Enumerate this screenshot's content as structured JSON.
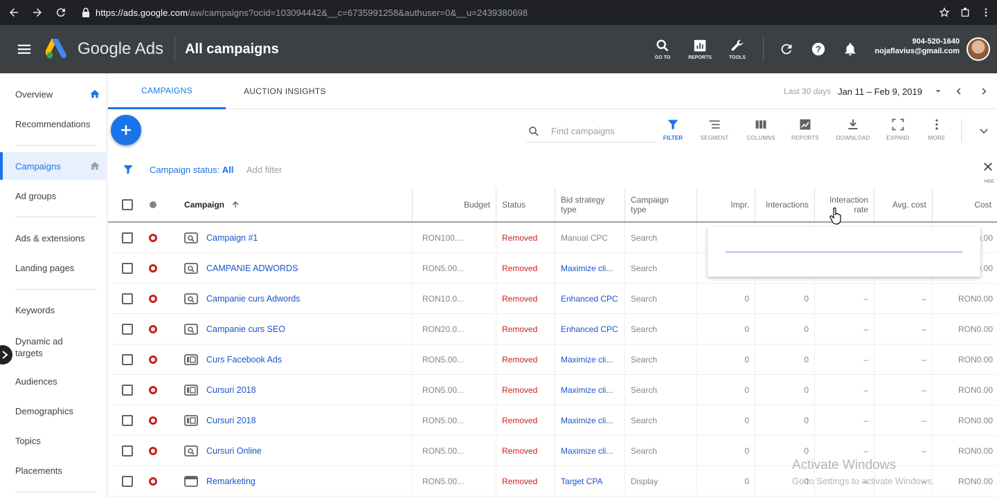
{
  "browser": {
    "url_host": "https://ads.google.com",
    "url_path": "/aw/campaigns?ocid=103094442&__c=6735991258&authuser=0&__u=2439380698"
  },
  "header": {
    "brand": "Google Ads",
    "page_title": "All campaigns",
    "tools": [
      {
        "label": "GO TO",
        "icon": "search-icon"
      },
      {
        "label": "REPORTS",
        "icon": "reports-icon"
      },
      {
        "label": "TOOLS",
        "icon": "wrench-icon"
      }
    ],
    "account_phone": "904-520-1640",
    "account_email": "nojaflavius@gmail.com"
  },
  "sidebar": {
    "items": [
      {
        "label": "Overview"
      },
      {
        "label": "Recommendations"
      },
      {
        "label": "Campaigns"
      },
      {
        "label": "Ad groups"
      },
      {
        "label": "Ads & extensions"
      },
      {
        "label": "Landing pages"
      },
      {
        "label": "Keywords"
      },
      {
        "label": "Dynamic ad targets"
      },
      {
        "label": "Audiences"
      },
      {
        "label": "Demographics"
      },
      {
        "label": "Topics"
      },
      {
        "label": "Placements"
      }
    ]
  },
  "tabs": {
    "campaigns": "CAMPAIGNS",
    "auction_insights": "AUCTION INSIGHTS",
    "date_label": "Last 30 days",
    "date_range": "Jan 11 – Feb 9, 2019"
  },
  "toolbar": {
    "search_placeholder": "Find campaigns",
    "buttons": [
      {
        "label": "FILTER",
        "icon": "filter-icon"
      },
      {
        "label": "SEGMENT",
        "icon": "segment-icon"
      },
      {
        "label": "COLUMNS",
        "icon": "columns-icon"
      },
      {
        "label": "REPORTS",
        "icon": "reports-icon"
      },
      {
        "label": "DOWNLOAD",
        "icon": "download-icon"
      },
      {
        "label": "EXPAND",
        "icon": "expand-icon"
      },
      {
        "label": "MORE",
        "icon": "more-icon"
      }
    ]
  },
  "filter": {
    "status_label": "Campaign status:",
    "status_value": "All",
    "add_filter": "Add filter",
    "hide": "HIDE"
  },
  "table": {
    "headers": {
      "campaign": "Campaign",
      "budget": "Budget",
      "status": "Status",
      "bid_strategy": "Bid strategy type",
      "campaign_type": "Campaign type",
      "impr": "Impr.",
      "interactions": "Interactions",
      "interaction_rate": "Interaction rate",
      "avg_cost": "Avg. cost",
      "cost": "Cost"
    },
    "rows": [
      {
        "name": "Campaign #1",
        "type_icon": "search-campaign-icon",
        "budget": "RON100....",
        "status": "Removed",
        "bid": "Manual CPC",
        "bid_link": false,
        "ctype": "Search",
        "impr": "",
        "interactions": "",
        "rate": "",
        "avg": "",
        "cost": "RON0.00"
      },
      {
        "name": "CAMPANIE ADWORDS",
        "type_icon": "search-campaign-icon",
        "budget": "RON5.00...",
        "status": "Removed",
        "bid": "Maximize cli...",
        "bid_link": true,
        "ctype": "Search",
        "impr": "",
        "interactions": "",
        "rate": "",
        "avg": "",
        "cost": "RON0.00"
      },
      {
        "name": "Campanie curs Adwords",
        "type_icon": "search-campaign-icon",
        "budget": "RON10.0...",
        "status": "Removed",
        "bid": "Enhanced CPC",
        "bid_link": true,
        "ctype": "Search",
        "impr": "0",
        "interactions": "0",
        "rate": "–",
        "avg": "–",
        "cost": "RON0.00"
      },
      {
        "name": "Campanie curs SEO",
        "type_icon": "search-campaign-icon",
        "budget": "RON20.0...",
        "status": "Removed",
        "bid": "Enhanced CPC",
        "bid_link": true,
        "ctype": "Search",
        "impr": "0",
        "interactions": "0",
        "rate": "–",
        "avg": "–",
        "cost": "RON0.00"
      },
      {
        "name": "Curs Facebook Ads",
        "type_icon": "video-campaign-icon",
        "budget": "RON5.00...",
        "status": "Removed",
        "bid": "Maximize cli...",
        "bid_link": true,
        "ctype": "Search",
        "impr": "0",
        "interactions": "0",
        "rate": "–",
        "avg": "–",
        "cost": "RON0.00"
      },
      {
        "name": "Cursuri 2018",
        "type_icon": "video-campaign-icon",
        "budget": "RON5.00...",
        "status": "Removed",
        "bid": "Maximize cli...",
        "bid_link": true,
        "ctype": "Search",
        "impr": "0",
        "interactions": "0",
        "rate": "–",
        "avg": "–",
        "cost": "RON0.00"
      },
      {
        "name": "Cursuri 2018",
        "type_icon": "video-campaign-icon",
        "budget": "RON5.00...",
        "status": "Removed",
        "bid": "Maximize cli...",
        "bid_link": true,
        "ctype": "Search",
        "impr": "0",
        "interactions": "0",
        "rate": "–",
        "avg": "–",
        "cost": "RON0.00"
      },
      {
        "name": "Cursuri Online",
        "type_icon": "search-campaign-icon",
        "budget": "RON5.00...",
        "status": "Removed",
        "bid": "Maximize cli...",
        "bid_link": true,
        "ctype": "Search",
        "impr": "0",
        "interactions": "0",
        "rate": "–",
        "avg": "–",
        "cost": "RON0.00"
      },
      {
        "name": "Remarketing",
        "type_icon": "display-campaign-icon",
        "budget": "RON5.00...",
        "status": "Removed",
        "bid": "Target CPA",
        "bid_link": true,
        "ctype": "Display",
        "impr": "0",
        "interactions": "0",
        "rate": "–",
        "avg": "–",
        "cost": "RON0.00"
      }
    ]
  },
  "watermark": {
    "line1": "Activate Windows",
    "line2": "Go to Settings to activate Windows."
  },
  "colors": {
    "accent": "#1a73e8",
    "removed": "#c5221f",
    "header_bg": "#3c4043"
  }
}
